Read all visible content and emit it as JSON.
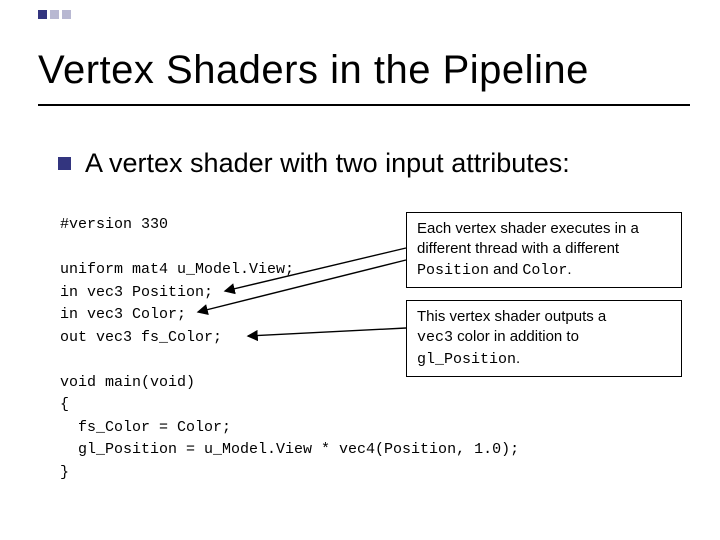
{
  "title": "Vertex Shaders in the Pipeline",
  "bullet": "A vertex shader with two input attributes:",
  "code": {
    "l1": "#version 330",
    "l2": "",
    "l3": "uniform mat4 u_Model.View;",
    "l4": "in vec3 Position;",
    "l5": "in vec3 Color;",
    "l6": "out vec3 fs_Color;",
    "l7": "",
    "l8": "void main(void)",
    "l9": "{",
    "l10": "  fs_Color = Color;",
    "l11": "  gl_Position = u_Model.View * vec4(Position, 1.0);",
    "l12": "}"
  },
  "box1": {
    "t1": "Each vertex shader executes in a",
    "t2": "different thread with a different",
    "m1": "Position",
    "t3": " and ",
    "m2": "Color",
    "t4": "."
  },
  "box2": {
    "t1": "This vertex shader outputs a",
    "m1": "vec3",
    "t2": " color in addition to",
    "m2": "gl_Position",
    "t3": "."
  }
}
